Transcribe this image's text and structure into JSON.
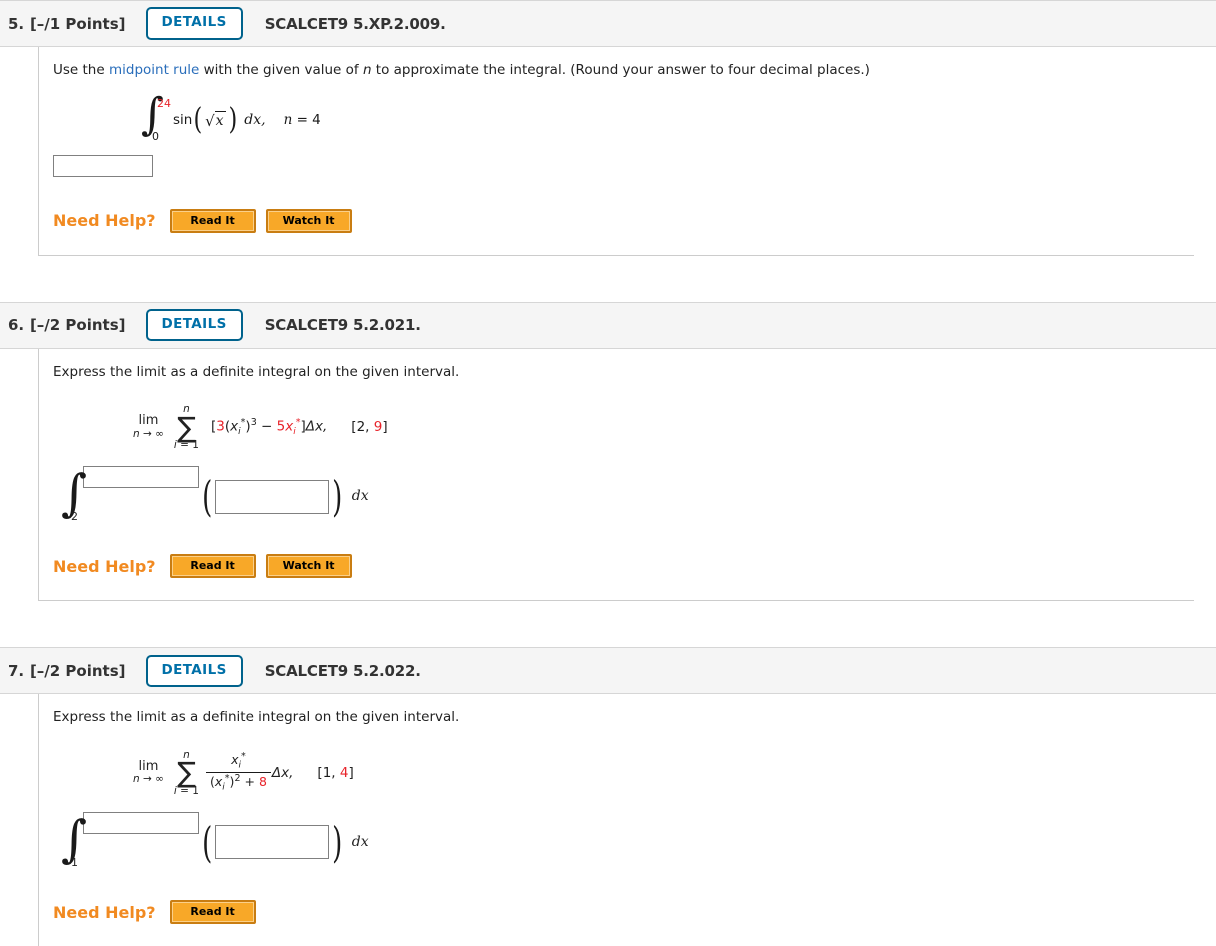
{
  "problems": [
    {
      "number": "5.",
      "points": "[–/1 Points]",
      "details_label": "DETAILS",
      "code": "SCALCET9 5.XP.2.009.",
      "prompt_part1": "Use the ",
      "prompt_link": "midpoint rule",
      "prompt_part2": " with the given value of ",
      "prompt_var": "n",
      "prompt_part3": " to approximate the integral. (Round your answer to four decimal places.)",
      "integral": {
        "symbol": "∫",
        "upper": "24",
        "lower": "0",
        "function": "sin",
        "radical": "√",
        "radicand": "x",
        "differential": "dx,",
        "condition_var": "n",
        "condition_eq": "=",
        "condition_val": "4"
      },
      "answer_box_value": "",
      "need_help_label": "Need Help?",
      "help_buttons": [
        "Read It",
        "Watch It"
      ]
    },
    {
      "number": "6.",
      "points": "[–/2 Points]",
      "details_label": "DETAILS",
      "code": "SCALCET9 5.2.021.",
      "prompt": "Express the limit as a definite integral on the given interval.",
      "limit": {
        "lim": "lim",
        "lim_sub_n": "n",
        "lim_sub_arrow": "→ ∞",
        "sigma_top": "n",
        "sigma": "∑",
        "sigma_bot_i": "i",
        "sigma_bot_eq": "= 1",
        "open_bracket": "[",
        "coef_a": "3",
        "term_open": "(",
        "var_x": "x",
        "var_sub": "i",
        "var_star": "*",
        "term_close": ")",
        "exponent": "3",
        "minus": "−",
        "coef_b": "5",
        "close_bracket": "]",
        "delta_x": "Δx,",
        "interval_open": "[",
        "interval_lower": "2",
        "interval_comma": ", ",
        "interval_upper": "9",
        "interval_close": "]"
      },
      "answer_integral": {
        "symbol": "∫",
        "lower": "2",
        "paren_open": "(",
        "paren_close": ")",
        "differential": "dx"
      },
      "upper_box_value": "",
      "integrand_box_value": "",
      "need_help_label": "Need Help?",
      "help_buttons": [
        "Read It",
        "Watch It"
      ]
    },
    {
      "number": "7.",
      "points": "[–/2 Points]",
      "details_label": "DETAILS",
      "code": "SCALCET9 5.2.022.",
      "prompt": "Express the limit as a definite integral on the given interval.",
      "limit": {
        "lim": "lim",
        "lim_sub_n": "n",
        "lim_sub_arrow": "→ ∞",
        "sigma_top": "n",
        "sigma": "∑",
        "sigma_bot_i": "i",
        "sigma_bot_eq": "= 1",
        "num_var": "x",
        "num_sub": "i",
        "num_star": "*",
        "den_open": "(",
        "den_var": "x",
        "den_sub": "i",
        "den_star": "*",
        "den_close": ")",
        "den_exp": "2",
        "den_plus": "+",
        "den_const": "8",
        "delta_x": "Δx,",
        "interval_open": "[",
        "interval_lower": "1",
        "interval_comma": ", ",
        "interval_upper": "4",
        "interval_close": "]"
      },
      "answer_integral": {
        "symbol": "∫",
        "lower": "1",
        "paren_open": "(",
        "paren_close": ")",
        "differential": "dx"
      },
      "upper_box_value": "",
      "integrand_box_value": "",
      "need_help_label": "Need Help?",
      "help_buttons": [
        "Read It"
      ]
    }
  ],
  "colors": {
    "accent_blue": "#0070a8",
    "link_blue": "#2a6ebb",
    "highlight_red": "#e8232a",
    "help_orange": "#f18a21",
    "button_orange": "#f8a828",
    "header_bg": "#f5f5f5"
  }
}
